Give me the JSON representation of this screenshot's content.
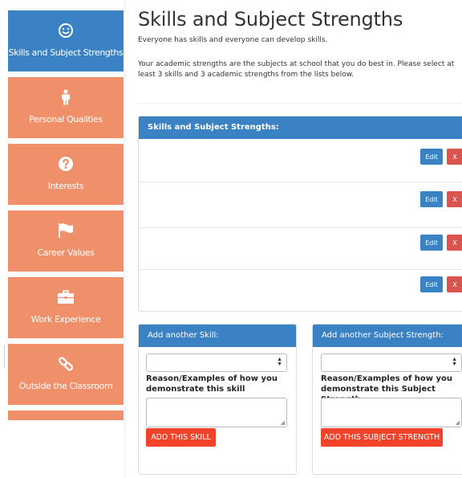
{
  "sidebar": {
    "items": [
      {
        "label": "Skills and Subject Strengths",
        "icon": "smile-icon",
        "active": true
      },
      {
        "label": "Personal Qualities",
        "icon": "person-icon",
        "active": false
      },
      {
        "label": "Interests",
        "icon": "question-circle-icon",
        "active": false
      },
      {
        "label": "Career Values",
        "icon": "flag-icon",
        "active": false
      },
      {
        "label": "Work Experience",
        "icon": "briefcase-icon",
        "active": false
      },
      {
        "label": "Outside the Classroom",
        "icon": "link-icon",
        "active": false
      }
    ]
  },
  "page": {
    "title": "Skills and Subject Strengths",
    "intro1": "Everyone has skills and everyone can develop skills.",
    "intro2": "Your academic strengths are the subjects at school that you do best in. Please select at least 3 skills and 3 academic strengths from the lists below."
  },
  "strengths_panel": {
    "title": "Skills and Subject Strengths:",
    "rows": [
      {
        "edit": "Edit",
        "delete": "X"
      },
      {
        "edit": "Edit",
        "delete": "X"
      },
      {
        "edit": "Edit",
        "delete": "X"
      },
      {
        "edit": "Edit",
        "delete": "X"
      }
    ]
  },
  "add_skill": {
    "title": "Add another Skill:",
    "select_value": "",
    "reason_label": "Reason/Examples of how you demonstrate this skill",
    "textarea_value": "",
    "button": "ADD THIS SKILL"
  },
  "add_subject": {
    "title": "Add another Subject Strength:",
    "select_value": "",
    "reason_label": "Reason/Examples of how you demonstrate this Subject Strength",
    "textarea_value": "",
    "button": "ADD THIS SUBJECT STRENGTH"
  },
  "colors": {
    "primary": "#3a82c4",
    "sidebar": "#f0906b",
    "danger": "#d9534f",
    "add_button": "#f0432a"
  }
}
